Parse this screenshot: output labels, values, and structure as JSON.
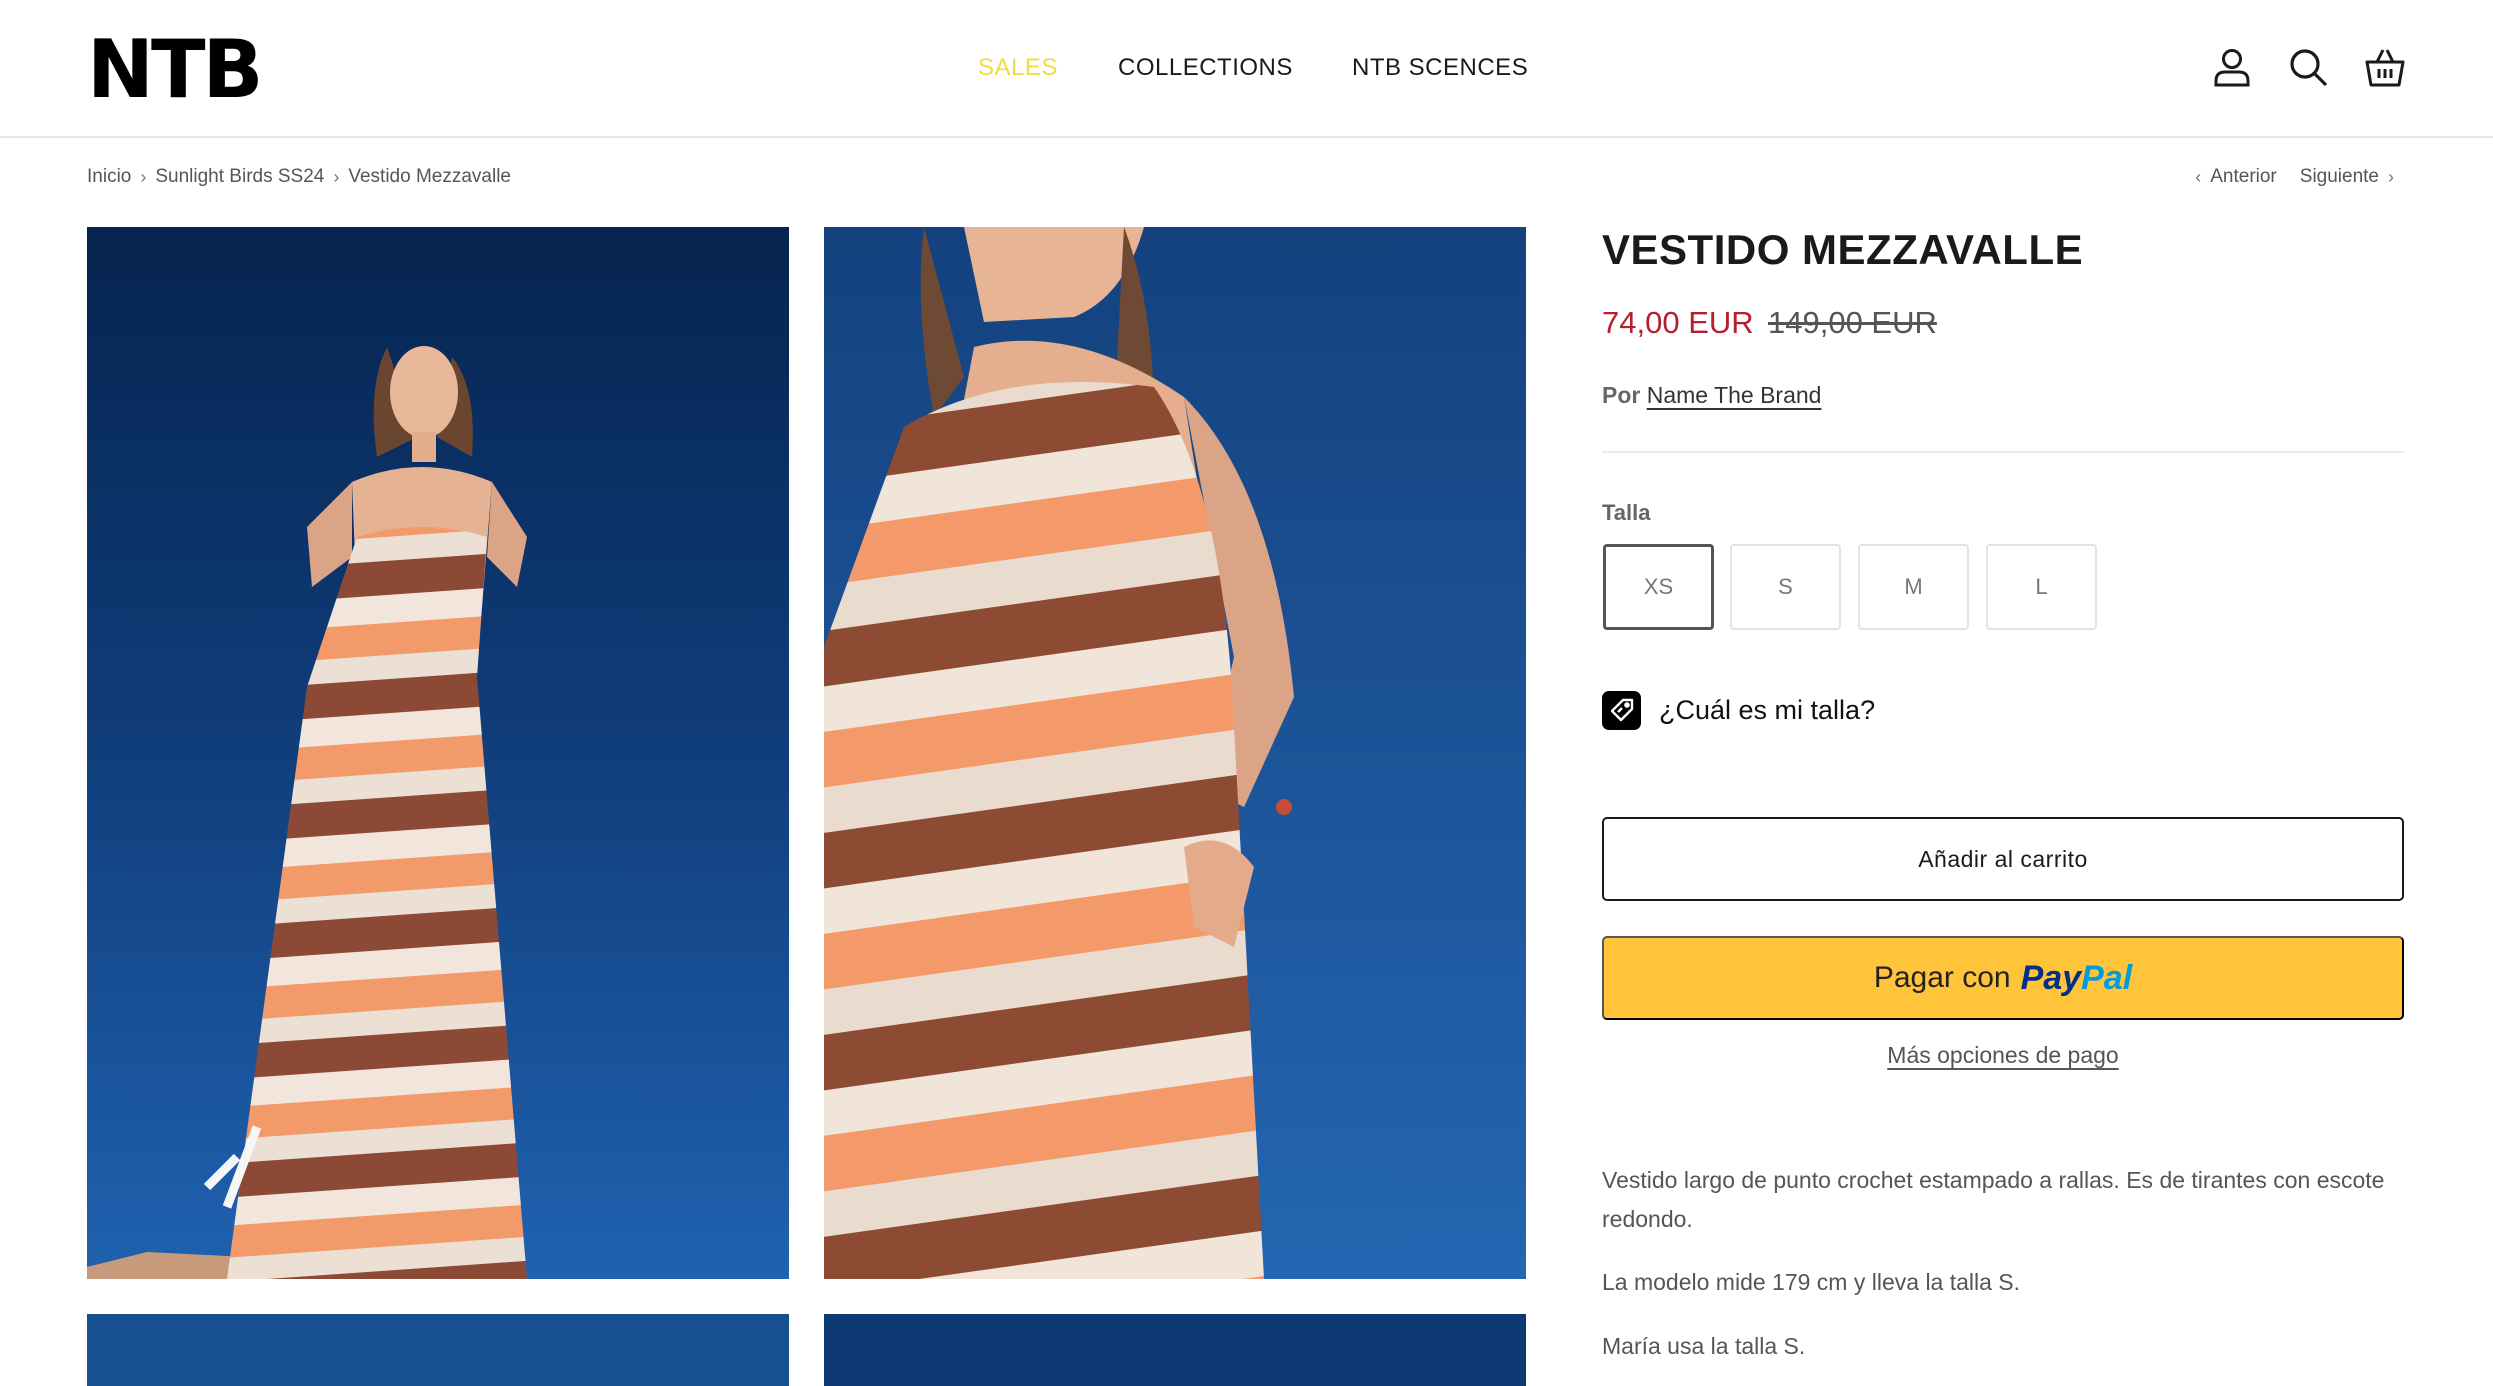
{
  "header": {
    "logo": "NTB",
    "nav": [
      {
        "label": "SALES"
      },
      {
        "label": "COLLECTIONS"
      },
      {
        "label": "NTB SCENCES"
      }
    ],
    "icons": [
      "account-icon",
      "search-icon",
      "cart-icon"
    ]
  },
  "breadcrumb": {
    "items": [
      "Inicio",
      "Sunlight Birds SS24",
      "Vestido Mezzavalle"
    ]
  },
  "pager": {
    "prev": "Anterior",
    "next": "Siguiente"
  },
  "product": {
    "title": "VESTIDO MEZZAVALLE",
    "price": "74,00 EUR",
    "compare_price": "149,00 EUR",
    "vendor_prefix": "Por",
    "vendor": "Name The Brand",
    "size_label": "Talla",
    "sizes": [
      "XS",
      "S",
      "M",
      "L"
    ],
    "selected_size": "XS",
    "fit_guide": "¿Cuál es mi talla?",
    "add_to_cart": "Añadir al carrito",
    "paypal_prefix": "Pagar con",
    "paypal_brand_1": "Pay",
    "paypal_brand_2": "Pal",
    "more_payment": "Más opciones de pago",
    "description": [
      "Vestido largo de punto crochet estampado a rallas. Es de tirantes con escote redondo.",
      "La modelo mide 179 cm y lleva la talla S.",
      "María usa la talla S."
    ]
  },
  "colors": {
    "sale_nav": "#eede43",
    "sale_price": "#b5202e",
    "paypal_button": "#ffc439",
    "sky": "#1b4f93"
  }
}
